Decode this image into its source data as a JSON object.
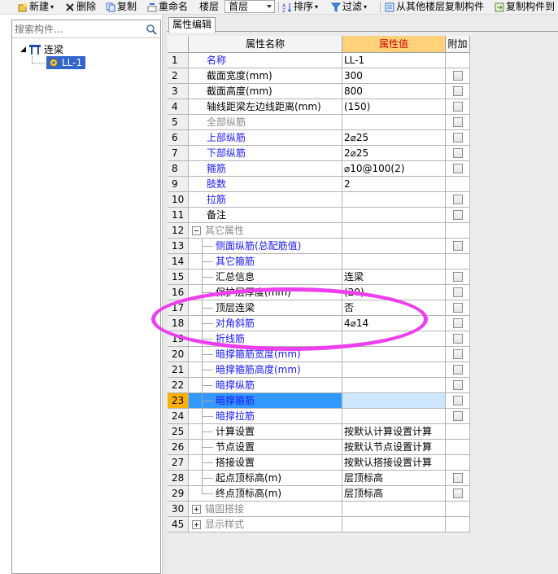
{
  "toolbar": {
    "new_label": "新建",
    "delete_label": "删除",
    "copy_label": "复制",
    "rename_label": "重命名",
    "floor_label": "楼层",
    "floor_value": "首层",
    "sort_label": "排序",
    "filter_label": "过滤",
    "copy_from_floor_label": "从其他楼层复制构件",
    "copy_to_label": "复制构件到"
  },
  "search": {
    "placeholder": "搜索构件..."
  },
  "tree": {
    "root": "连梁",
    "child": "LL-1"
  },
  "tab": {
    "label": "属性编辑"
  },
  "grid": {
    "headers": [
      "",
      "属性名称",
      "属性值",
      "附加"
    ],
    "rows": [
      {
        "num": "1",
        "name": "名称",
        "value": "LL-1",
        "style": "blue",
        "cb": false
      },
      {
        "num": "2",
        "name": "截面宽度(mm)",
        "value": "300",
        "style": "",
        "cb": true
      },
      {
        "num": "3",
        "name": "截面高度(mm)",
        "value": "800",
        "style": "",
        "cb": true
      },
      {
        "num": "4",
        "name": "轴线距梁左边线距离(mm)",
        "value": "(150)",
        "style": "",
        "cb": true
      },
      {
        "num": "5",
        "name": "全部纵筋",
        "value": "",
        "style": "grey",
        "cb": true
      },
      {
        "num": "6",
        "name": "上部纵筋",
        "value": "2⌀25",
        "style": "blue",
        "cb": true
      },
      {
        "num": "7",
        "name": "下部纵筋",
        "value": "2⌀25",
        "style": "blue",
        "cb": true
      },
      {
        "num": "8",
        "name": "箍筋",
        "value": "⌀10@100(2)",
        "style": "blue",
        "cb": true
      },
      {
        "num": "9",
        "name": "肢数",
        "value": "2",
        "style": "blue",
        "cb": false
      },
      {
        "num": "10",
        "name": "拉筋",
        "value": "",
        "style": "blue",
        "cb": true
      },
      {
        "num": "11",
        "name": "备注",
        "value": "",
        "style": "",
        "cb": true
      },
      {
        "num": "12",
        "name": "其它属性",
        "value": "",
        "style": "grey",
        "cb": false,
        "group": "minus"
      },
      {
        "num": "13",
        "name": "侧面纵筋(总配筋值)",
        "value": "",
        "style": "blue",
        "cb": true,
        "child": true
      },
      {
        "num": "14",
        "name": "其它箍筋",
        "value": "",
        "style": "blue",
        "cb": false,
        "child": true
      },
      {
        "num": "15",
        "name": "汇总信息",
        "value": "连梁",
        "style": "",
        "cb": true,
        "child": true
      },
      {
        "num": "16",
        "name": "保护层厚度(mm)",
        "value": "(20)",
        "style": "",
        "cb": true,
        "child": true
      },
      {
        "num": "17",
        "name": "顶层连梁",
        "value": "否",
        "style": "",
        "cb": true,
        "child": true
      },
      {
        "num": "18",
        "name": "对角斜筋",
        "value": "4⌀14",
        "style": "blue",
        "cb": true,
        "child": true
      },
      {
        "num": "19",
        "name": "折线筋",
        "value": "",
        "style": "blue",
        "cb": true,
        "child": true
      },
      {
        "num": "20",
        "name": "暗撑箍筋宽度(mm)",
        "value": "",
        "style": "blue",
        "cb": true,
        "child": true
      },
      {
        "num": "21",
        "name": "暗撑箍筋高度(mm)",
        "value": "",
        "style": "blue",
        "cb": true,
        "child": true
      },
      {
        "num": "22",
        "name": "暗撑纵筋",
        "value": "",
        "style": "blue",
        "cb": true,
        "child": true
      },
      {
        "num": "23",
        "name": "暗撑箍筋",
        "value": "",
        "style": "blue",
        "cb": true,
        "child": true,
        "selected": true
      },
      {
        "num": "24",
        "name": "暗撑拉筋",
        "value": "",
        "style": "blue",
        "cb": true,
        "child": true
      },
      {
        "num": "25",
        "name": "计算设置",
        "value": "按默认计算设置计算",
        "style": "",
        "cb": false,
        "child": true
      },
      {
        "num": "26",
        "name": "节点设置",
        "value": "按默认节点设置计算",
        "style": "",
        "cb": false,
        "child": true
      },
      {
        "num": "27",
        "name": "搭接设置",
        "value": "按默认搭接设置计算",
        "style": "",
        "cb": false,
        "child": true
      },
      {
        "num": "28",
        "name": "起点顶标高(m)",
        "value": "层顶标高",
        "style": "",
        "cb": true,
        "child": true
      },
      {
        "num": "29",
        "name": "终点顶标高(m)",
        "value": "层顶标高",
        "style": "",
        "cb": true,
        "child": true,
        "last": true
      },
      {
        "num": "30",
        "name": "锚固搭接",
        "value": "",
        "style": "grey",
        "cb": false,
        "group": "plus"
      },
      {
        "num": "45",
        "name": "显示样式",
        "value": "",
        "style": "grey",
        "cb": false,
        "group": "plus"
      }
    ]
  }
}
